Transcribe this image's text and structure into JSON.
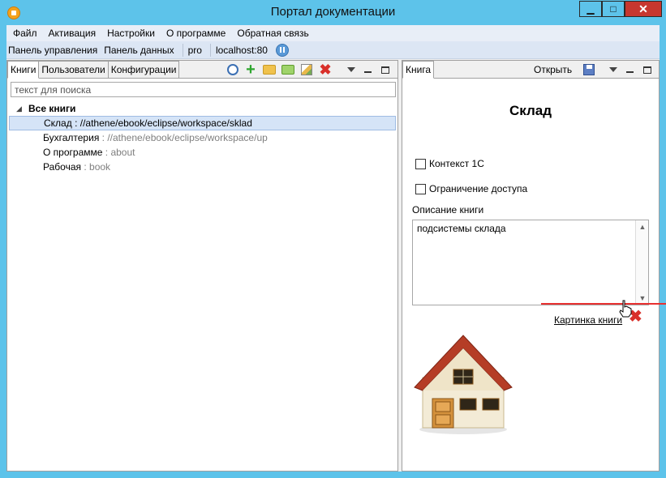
{
  "window": {
    "title": "Портал документации",
    "minimize": "▁",
    "maximize": "□",
    "close": "✕"
  },
  "menu": [
    "Файл",
    "Активация",
    "Настройки",
    "О программе",
    "Обратная связь"
  ],
  "toolbar": {
    "control_panel": "Панель управления",
    "data_panel": "Панель данных",
    "user": "pro",
    "server": "localhost:80"
  },
  "left_panel": {
    "tabs": [
      "Книги",
      "Пользователи",
      "Конфигурации"
    ],
    "search_placeholder": "текст для поиска",
    "tree": {
      "root": "Все книги",
      "items": [
        {
          "name": "Склад",
          "path": "//athene/ebook/eclipse/workspace/sklad"
        },
        {
          "name": "Бухгалтерия",
          "path": "//athene/ebook/eclipse/workspace/up"
        },
        {
          "name": "О программе",
          "path": "about"
        },
        {
          "name": "Рабочая",
          "path": "book"
        }
      ]
    }
  },
  "right_panel": {
    "tab": "Книга",
    "open_label": "Открыть",
    "book_title": "Склад",
    "context_1c": "Контекст 1С",
    "access_restriction": "Ограничение доступа",
    "description_label": "Описание книги",
    "description": "подсистемы склада",
    "picture_link": "Картинка книги"
  },
  "colors": {
    "titlebar": "#5dc3ea",
    "selection": "#d5e4f7",
    "accent_red": "#d9302a",
    "accent_green": "#2ea62e"
  }
}
